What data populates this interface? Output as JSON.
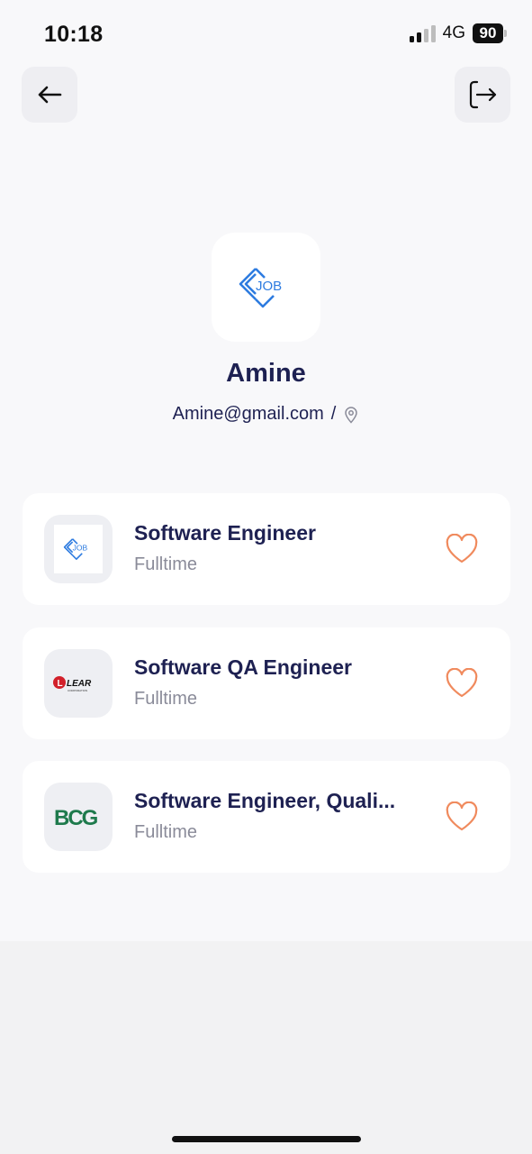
{
  "status_bar": {
    "time": "10:18",
    "network": "4G",
    "battery": "90"
  },
  "header": {
    "back_icon": "arrow-left-icon",
    "logout_icon": "logout-icon"
  },
  "profile": {
    "avatar_logo_text": "JOB",
    "name": "Amine",
    "email": "Amine@gmail.com",
    "separator": "/",
    "location_icon": "map-pin-icon"
  },
  "jobs": [
    {
      "title": "Software Engineer",
      "type": "Fulltime",
      "logo": "job-logo",
      "logo_text": "JOB"
    },
    {
      "title": "Software QA Engineer",
      "type": "Fulltime",
      "logo": "lear-logo",
      "logo_text": "LEAR",
      "logo_subtext": "CORPORATION"
    },
    {
      "title": "Software Engineer, Quali...",
      "type": "Fulltime",
      "logo": "bcg-logo",
      "logo_text": "BCG"
    }
  ],
  "colors": {
    "primary_text": "#1e2152",
    "secondary_text": "#8a8b99",
    "heart": "#f08a5d",
    "job_logo_blue": "#2d7be0",
    "lear_red": "#d2202a",
    "bcg_green": "#1e7a4c"
  }
}
